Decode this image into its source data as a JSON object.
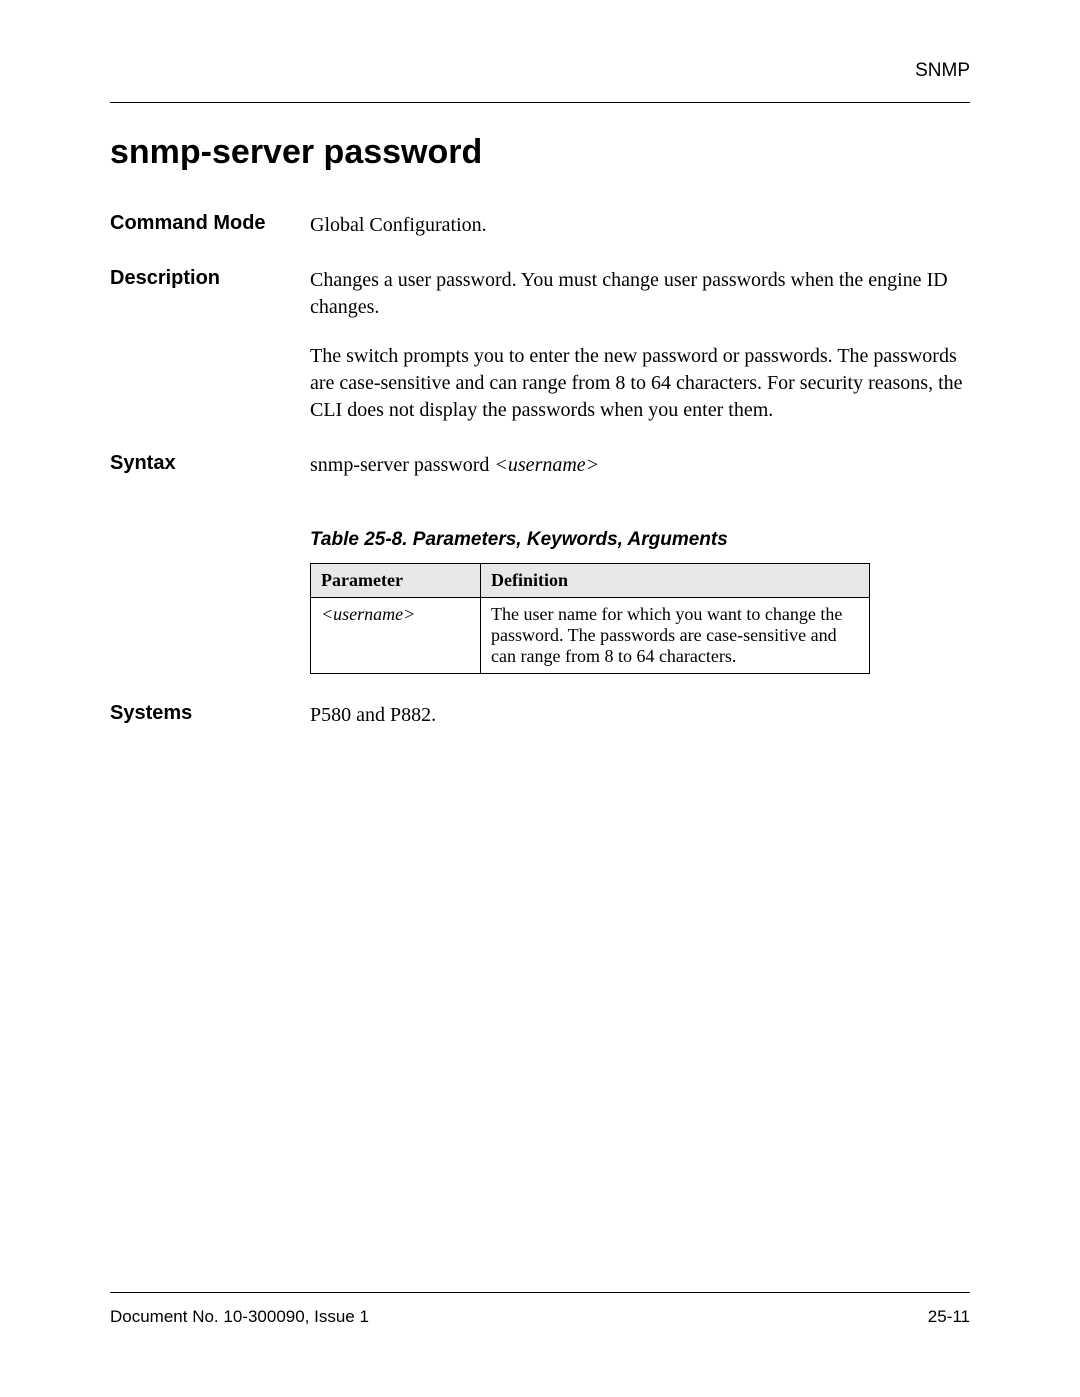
{
  "header": {
    "label": "SNMP"
  },
  "title": "snmp-server password",
  "sections": {
    "command_mode": {
      "label": "Command Mode",
      "value": "Global Configuration."
    },
    "description": {
      "label": "Description",
      "p1": "Changes a user password. You must change user passwords when the engine ID changes.",
      "p2": "The switch prompts you to enter the new password or passwords. The passwords are case-sensitive and can range from 8 to 64 characters. For security reasons, the CLI does not display the passwords when you enter them."
    },
    "syntax": {
      "label": "Syntax",
      "prefix": "snmp-server password ",
      "arg": "<username>"
    },
    "systems": {
      "label": "Systems",
      "value": "P580 and P882."
    }
  },
  "table": {
    "caption": "Table 25-8.  Parameters, Keywords, Arguments",
    "headers": {
      "col1": "Parameter",
      "col2": "Definition"
    },
    "row1": {
      "param": "<username>",
      "definition": "The user name for which you want to change the password. The passwords are case-sensitive and can range from 8 to 64 characters."
    }
  },
  "footer": {
    "doc": "Document No. 10-300090, Issue 1",
    "page": "25-11"
  }
}
